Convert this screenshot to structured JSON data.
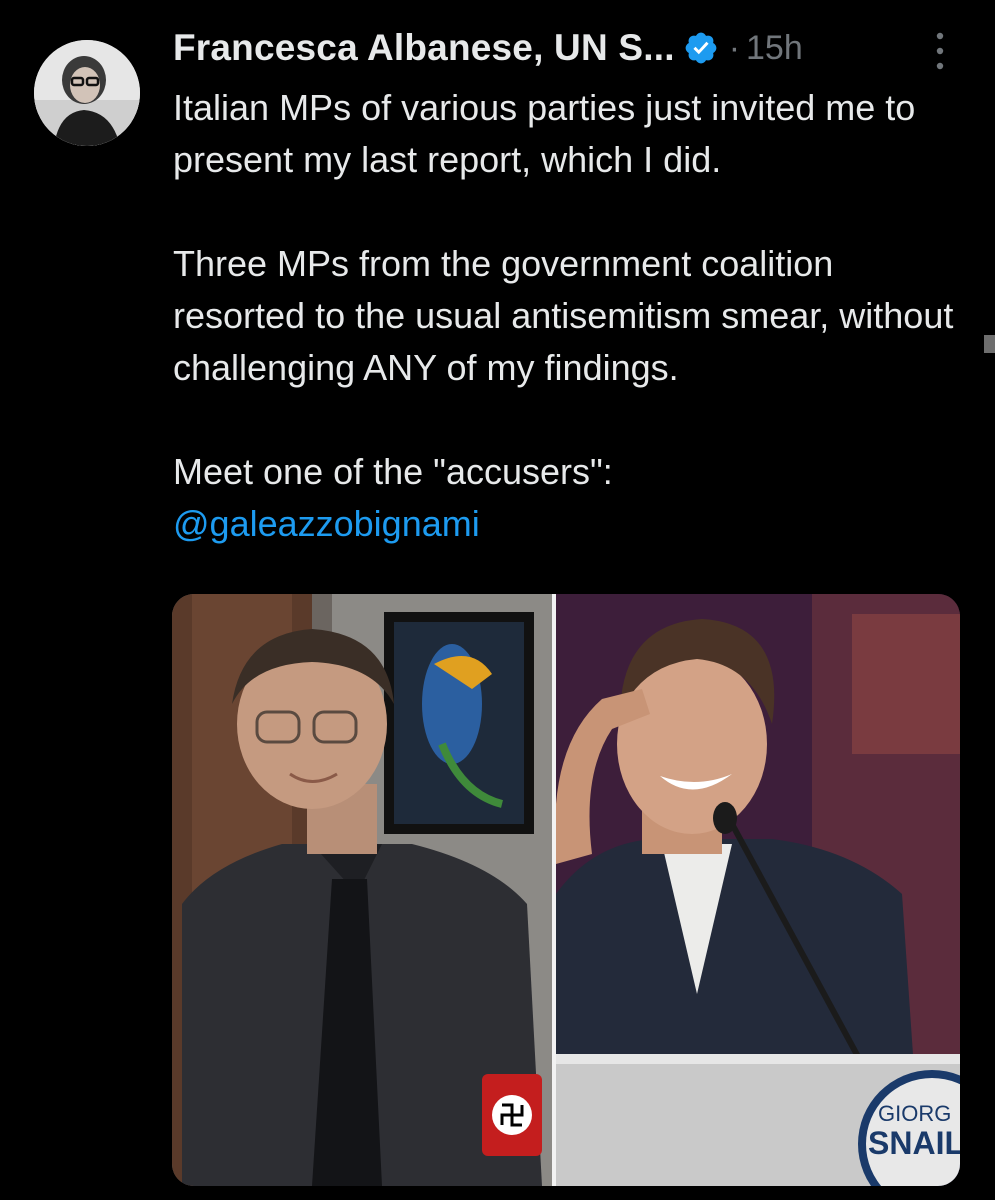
{
  "tweet": {
    "author": {
      "display_name": "Francesca Albanese, UN S...",
      "verified": true
    },
    "separator": "·",
    "timestamp": "15h",
    "body": {
      "paragraphs": [
        "Italian MPs of various parties just invited me to present my last report, which I did.",
        "Three MPs from the government coalition resorted to the usual antisemitism smear, without challenging ANY of my findings.",
        "Meet one of the \"accusers\":"
      ],
      "mention": "@galeazzobignami"
    },
    "media": {
      "sign_lines": [
        "GIORG",
        "SNAIL"
      ]
    }
  },
  "colors": {
    "background": "#000000",
    "text": "#e7e9ea",
    "muted": "#71767b",
    "link": "#1d9bf0",
    "verified": "#1d9bf0"
  },
  "icons": {
    "verified": "verified-badge-icon",
    "more": "more-vertical-icon"
  }
}
